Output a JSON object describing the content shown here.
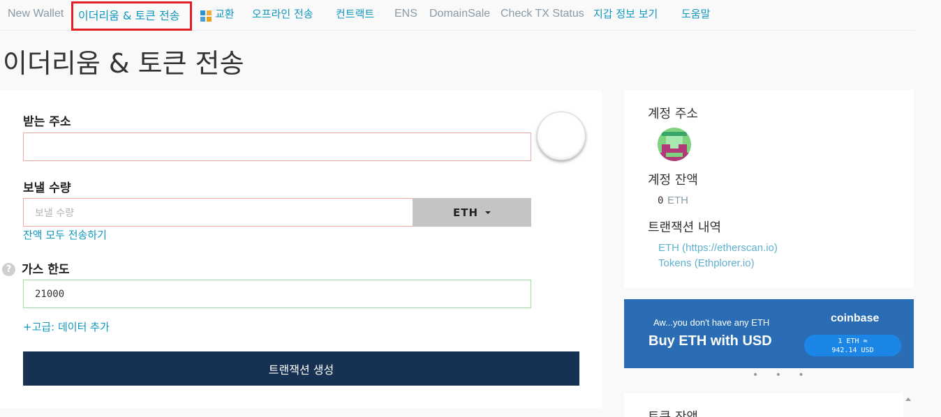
{
  "nav": {
    "items": [
      {
        "label": "New Wallet"
      },
      {
        "label": "이더리움 & 토큰 전송"
      },
      {
        "label": "교환"
      },
      {
        "label": "오프라인 전송"
      },
      {
        "label": "컨트랙트"
      },
      {
        "label": "ENS"
      },
      {
        "label": "DomainSale"
      },
      {
        "label": "Check TX Status"
      },
      {
        "label": "지갑 정보 보기"
      },
      {
        "label": "도움말"
      }
    ]
  },
  "page": {
    "title": "이더리움 & 토큰 전송"
  },
  "form": {
    "to_label": "받는 주소",
    "to_value": "",
    "amount_label": "보낼 수량",
    "amount_placeholder": "보낼 수량",
    "unit": "ETH",
    "send_all_link": "잔액 모두 전송하기",
    "help_icon": "?",
    "gas_label": "가스 한도",
    "gas_value": "21000",
    "advanced_link": "+고급: 데이터 추가",
    "submit_label": "트랜잭션 생성"
  },
  "account": {
    "address_label": "계정 주소",
    "balance_label": "계정 잔액",
    "balance_value": "0",
    "balance_unit": "ETH",
    "history_label": "트랜잭션 내역",
    "history_links": [
      {
        "label": "ETH (https://etherscan.io)"
      },
      {
        "label": "Tokens (Ethplorer.io)"
      }
    ]
  },
  "coinbase": {
    "tagline": "Aw...you don't have any ETH",
    "headline": "Buy ETH with USD",
    "brand": "coinbase",
    "price_line1": "1 ETH ≈",
    "price_line2": "942.14 USD"
  },
  "dots": "• • •",
  "token_balance": {
    "title": "토큰 잔액"
  },
  "colors": {
    "accent": "#0e97c0",
    "highlight": "#e31c25",
    "submit": "#163151",
    "coinbase": "#2a6db5"
  }
}
